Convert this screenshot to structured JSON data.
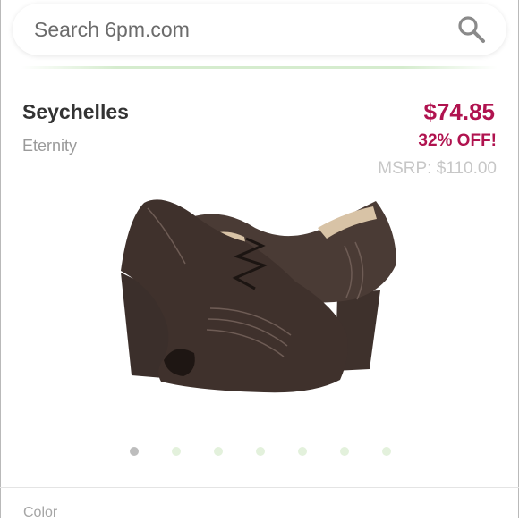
{
  "search": {
    "placeholder": "Search 6pm.com",
    "icon": "search-icon"
  },
  "product": {
    "brand": "Seychelles",
    "name": "Eternity",
    "price": "$74.85",
    "discount": "32% OFF!",
    "msrp": "MSRP: $110.00"
  },
  "gallery": {
    "image_icon": "peep-toe-oxford-bootie-image",
    "total_images": 7,
    "active_index": 0
  },
  "options": {
    "color_label": "Color"
  },
  "colors": {
    "price": "#b0134f",
    "accent_green": "#d5ecce",
    "dot_inactive": "#e3f1dc",
    "dot_active": "#bdbdbd"
  }
}
